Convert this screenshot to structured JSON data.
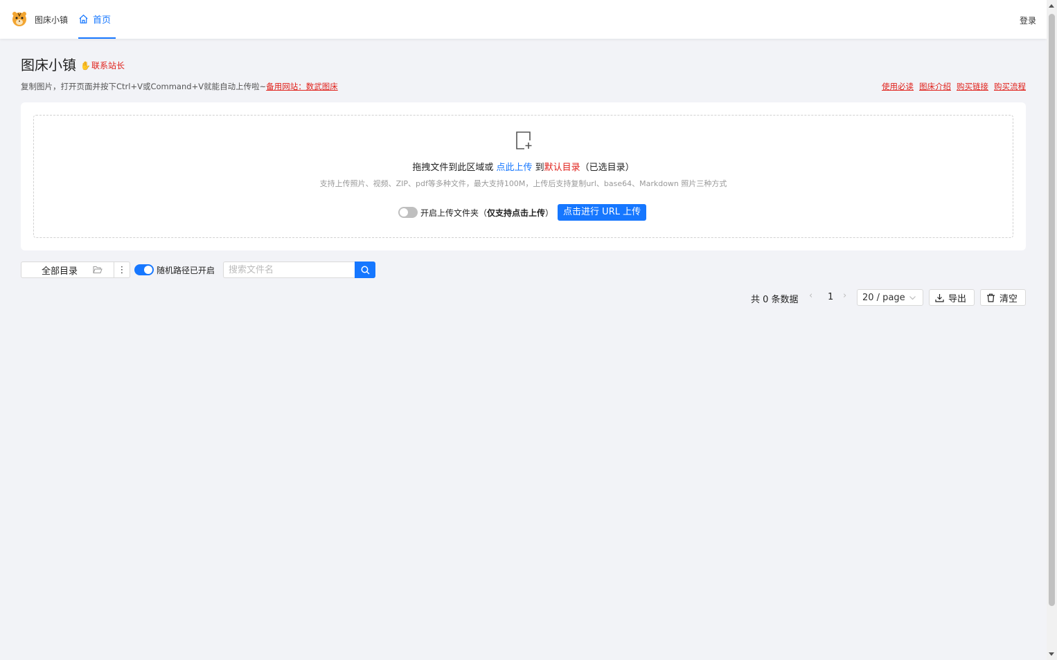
{
  "nav": {
    "brand": "图床小镇",
    "home": "首页",
    "login": "登录"
  },
  "header": {
    "title": "图床小镇",
    "contact": "联系站长",
    "desc_prefix": "复制图片，打开页面并按下Ctrl+V或Command+V就能自动上传啦~",
    "backup_link": "备用网站：数武图床",
    "right_links": [
      "使用必读",
      "图床介绍",
      "购买链接",
      "购买流程"
    ]
  },
  "upload": {
    "drag_text": "拖拽文件到此区域或 ",
    "click_upload": "点此上传",
    "to": " 到",
    "default_dir": "默认目录",
    "selected_dir": "（已选目录）",
    "hint": "支持上传照片、视频、ZIP、pdf等多种文件，最大支持100M，上传后支持复制url、base64、Markdown 照片三种方式",
    "folder_toggle": "开启上传文件夹（",
    "folder_note": "仅支持点击上传",
    "folder_close": "）",
    "url_button": "点击进行 URL 上传",
    "folder_toggle_on": false
  },
  "toolbar": {
    "dir_label": "全部目录",
    "more": "⋮",
    "random_label": "随机路径已开启",
    "random_on": true,
    "search_placeholder": "搜索文件名"
  },
  "pagination": {
    "total": "共 0 条数据",
    "prev": "‹",
    "page": "1",
    "next": "›",
    "page_size": "20 / page",
    "export": "导出",
    "clear": "清空"
  },
  "colors": {
    "accent": "#1677ff",
    "link_red": "#e0201a",
    "background": "#f2f3f7"
  }
}
